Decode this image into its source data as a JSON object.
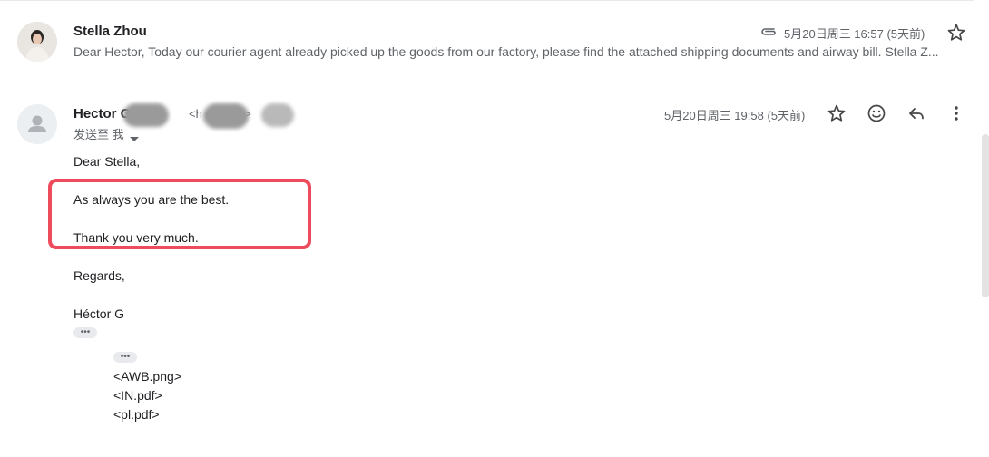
{
  "message1": {
    "sender": "Stella Zhou",
    "snippet": "Dear Hector, Today our courier agent already picked up the goods from our factory, please find the attached shipping documents and airway bill. Stella Z...",
    "date": "5月20日周三 16:57 (5天前)",
    "icons": [
      "paperclip-icon",
      "star-icon"
    ]
  },
  "message2": {
    "sender": "Hector G      lez",
    "sender_email": "<h              no.com>",
    "recipients": "发送至 我",
    "date": "5月20日周三 19:58 (5天前)",
    "icons": [
      "star-icon",
      "emoji-icon",
      "reply-icon",
      "more-vert-icon"
    ]
  },
  "body": {
    "greeting": "Dear Stella,",
    "line1": "As always you are the best.",
    "line2": "Thank you very much.",
    "regards": "Regards,",
    "signature": "Héctor G",
    "dots": "•••",
    "attachments": [
      "<AWB.png>",
      "<IN.pdf>",
      "<pl.pdf>"
    ]
  },
  "colors": {
    "highlight": "#ee4c5c",
    "text": "#202124",
    "muted": "#5f6368"
  }
}
